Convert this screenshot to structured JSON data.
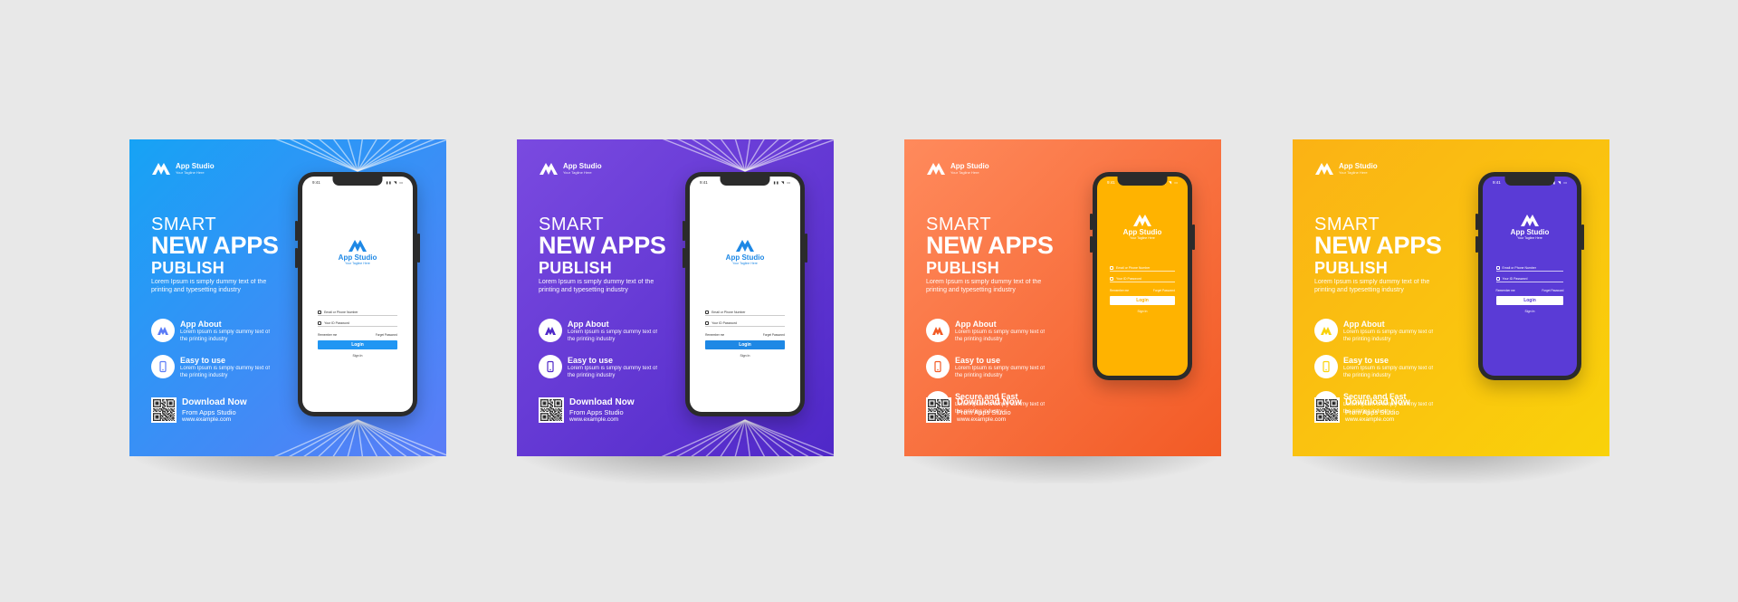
{
  "brand": {
    "name": "App Studio",
    "tagline": "Your Tagline Here"
  },
  "headline": {
    "line1": "SMART",
    "line2": "NEW APPS",
    "line3": "PUBLISH"
  },
  "intro": "Lorem Ipsum is simply dummy text of the printing and typesetting industry",
  "features": [
    {
      "title": "App About",
      "desc": "Lorem Ipsum is simply dummy text of the printing industry",
      "icon": "app-logo-icon"
    },
    {
      "title": "Easy to use",
      "desc": "Lorem Ipsum is simply dummy text of the printing industry",
      "icon": "smartphone-icon"
    },
    {
      "title": "Secure and Fast",
      "desc": "Lorem Ipsum is simply dummy text of the printing industry",
      "icon": "shield-icon"
    }
  ],
  "download": {
    "title": "Download Now",
    "sub": "From Apps Studio",
    "url": "www.example.com"
  },
  "phone_screen": {
    "time": "9:41",
    "email_placeholder": "Email or Phone Number",
    "password_placeholder": "Your ID Password",
    "remember": "Remember me",
    "forgot": "Forget Password",
    "login": "Login",
    "signin": "Sign In"
  },
  "cards": [
    {
      "theme": "blue",
      "bg_from": "#16a3f5",
      "bg_to": "#5b7cf7",
      "accent": "#2196f3",
      "screen_bg": "#ffffff",
      "screen_text": "#1e88e5",
      "feature_count": 2
    },
    {
      "theme": "purple",
      "bg_from": "#7a4ae0",
      "bg_to": "#4f28c8",
      "accent": "#1e88e5",
      "screen_bg": "#ffffff",
      "screen_text": "#1e88e5",
      "feature_count": 2
    },
    {
      "theme": "orange",
      "bg_from": "#ff8a5c",
      "bg_to": "#f25a25",
      "accent": "#ffb300",
      "screen_bg": "#ffb300",
      "screen_text": "#ffffff",
      "feature_count": 3
    },
    {
      "theme": "yellow",
      "bg_from": "#fbb215",
      "bg_to": "#f9d20a",
      "accent": "#5a3bd6",
      "screen_bg": "#5a3bd6",
      "screen_text": "#ffffff",
      "feature_count": 3
    }
  ]
}
